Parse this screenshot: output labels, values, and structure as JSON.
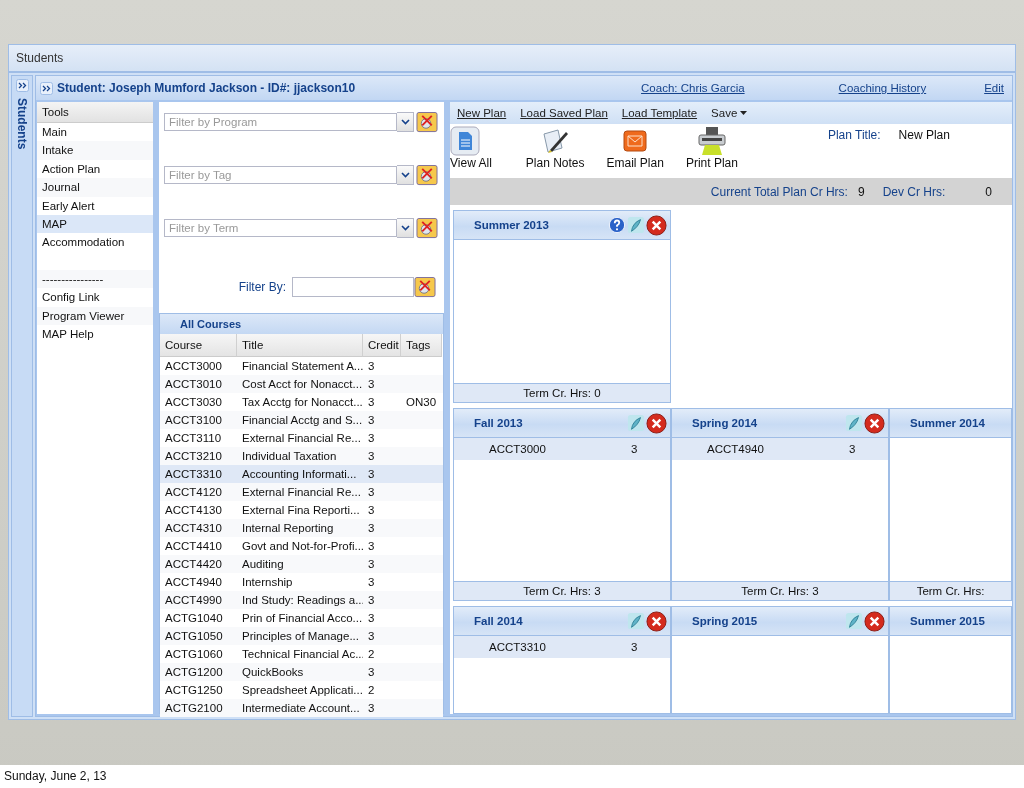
{
  "window": {
    "title": "Students"
  },
  "side_strip": {
    "label": "Students"
  },
  "header": {
    "student": "Student: Joseph Mumford Jackson - ID#: jjackson10",
    "links": [
      "Coach: Chris Garcia",
      "Coaching History",
      "Edit"
    ]
  },
  "tools": {
    "title": "Tools",
    "items": [
      {
        "label": "Main",
        "kind": "item",
        "selected": false
      },
      {
        "label": "Intake",
        "kind": "item",
        "selected": false
      },
      {
        "label": "Action Plan",
        "kind": "item",
        "selected": false
      },
      {
        "label": "Journal",
        "kind": "item",
        "selected": false
      },
      {
        "label": "Early Alert",
        "kind": "item",
        "selected": false
      },
      {
        "label": "MAP",
        "kind": "item",
        "selected": true
      },
      {
        "label": "Accommodation",
        "kind": "item",
        "selected": false
      },
      {
        "label": "----------------",
        "kind": "divider",
        "selected": false
      },
      {
        "label": "Config Link",
        "kind": "item",
        "selected": false
      },
      {
        "label": "Program Viewer",
        "kind": "item",
        "selected": false
      },
      {
        "label": "MAP Help",
        "kind": "item",
        "selected": false
      }
    ]
  },
  "filters": {
    "dropdowns": [
      {
        "placeholder": "Filter by Program"
      },
      {
        "placeholder": "Filter by Tag"
      },
      {
        "placeholder": "Filter by Term"
      }
    ],
    "filter_by": {
      "label": "Filter By:"
    }
  },
  "courses": {
    "title": "All Courses",
    "columns": [
      "Course",
      "Title",
      "Credit",
      "Tags"
    ],
    "rows": [
      {
        "course": "ACCT3000",
        "title": "Financial Statement A...",
        "credit": "3",
        "selected": false
      },
      {
        "course": "ACCT3010",
        "title": "Cost Acct for Nonacct...",
        "credit": "3",
        "selected": false
      },
      {
        "course": "ACCT3030",
        "title": "Tax Acctg for Nonacct...",
        "credit": "3",
        "tags": "ON30",
        "selected": false
      },
      {
        "course": "ACCT3100",
        "title": "Financial Acctg and S...",
        "credit": "3",
        "selected": false
      },
      {
        "course": "ACCT3110",
        "title": "External Financial Re...",
        "credit": "3",
        "selected": false
      },
      {
        "course": "ACCT3210",
        "title": "Individual Taxation",
        "credit": "3",
        "selected": false
      },
      {
        "course": "ACCT3310",
        "title": "Accounting Informati...",
        "credit": "3",
        "selected": true
      },
      {
        "course": "ACCT4120",
        "title": "External Financial Re...",
        "credit": "3",
        "selected": false
      },
      {
        "course": "ACCT4130",
        "title": "External Fina Reporti...",
        "credit": "3",
        "selected": false
      },
      {
        "course": "ACCT4310",
        "title": "Internal Reporting",
        "credit": "3",
        "selected": false
      },
      {
        "course": "ACCT4410",
        "title": "Govt and Not-for-Profi...",
        "credit": "3",
        "selected": false
      },
      {
        "course": "ACCT4420",
        "title": "Auditing",
        "credit": "3",
        "selected": false
      },
      {
        "course": "ACCT4940",
        "title": "Internship",
        "credit": "3",
        "selected": false
      },
      {
        "course": "ACCT4990",
        "title": "Ind Study: Readings a...",
        "credit": "3",
        "selected": false
      },
      {
        "course": "ACTG1040",
        "title": "Prin of Financial Acco...",
        "credit": "3",
        "selected": false
      },
      {
        "course": "ACTG1050",
        "title": "Principles of Manage...",
        "credit": "3",
        "selected": false
      },
      {
        "course": "ACTG1060",
        "title": "Technical Financial Ac...",
        "credit": "2",
        "selected": false
      },
      {
        "course": "ACTG1200",
        "title": "QuickBooks",
        "credit": "3",
        "selected": false
      },
      {
        "course": "ACTG1250",
        "title": "Spreadsheet Applicati...",
        "credit": "2",
        "selected": false
      },
      {
        "course": "ACTG2100",
        "title": "Intermediate Account...",
        "credit": "3",
        "selected": false
      }
    ]
  },
  "plan": {
    "menu": [
      {
        "label": "New Plan",
        "kind": "link"
      },
      {
        "label": "Load Saved Plan",
        "kind": "link"
      },
      {
        "label": "Load Template",
        "kind": "link"
      },
      {
        "label": "Save",
        "kind": "menu"
      }
    ],
    "actions": [
      {
        "label": "View All",
        "kind": "document"
      },
      {
        "label": "Plan Notes",
        "kind": "notes"
      },
      {
        "label": "Email Plan",
        "kind": "email"
      },
      {
        "label": "Print Plan",
        "kind": "print"
      }
    ],
    "plan_title_label": "Plan Title:",
    "plan_title": "New Plan",
    "total_label": "Current Total Plan Cr Hrs:",
    "total": "9",
    "dev_label": "Dev Cr Hrs:",
    "dev": "0",
    "term_rows": [
      [
        {
          "name": "Summer 2013",
          "help_button": true,
          "notes_button": true,
          "remove_button": true,
          "footer": "Term Cr. Hrs: 0"
        }
      ],
      [
        {
          "name": "Fall 2013",
          "help_button": false,
          "notes_button": true,
          "remove_button": true,
          "courses": [
            {
              "code": "ACCT3000",
              "credits": "3"
            }
          ],
          "footer": "Term Cr. Hrs: 3"
        },
        {
          "name": "Spring 2014",
          "help_button": false,
          "notes_button": true,
          "remove_button": true,
          "courses": [
            {
              "code": "ACCT4940",
              "credits": "3"
            }
          ],
          "footer": "Term Cr. Hrs: 3"
        },
        {
          "name": "Summer 2014",
          "help_button": false,
          "notes_button": false,
          "remove_button": false,
          "footer": "Term Cr. Hrs:"
        }
      ],
      [
        {
          "name": "Fall 2014",
          "help_button": false,
          "notes_button": true,
          "remove_button": true,
          "courses": [
            {
              "code": "ACCT3310",
              "credits": "3"
            }
          ]
        },
        {
          "name": "Spring 2015",
          "help_button": false,
          "notes_button": true,
          "remove_button": true
        },
        {
          "name": "Summer 2015",
          "help_button": false,
          "notes_button": false,
          "remove_button": false
        }
      ]
    ]
  },
  "slide_caption": "Sunday, June 2, 13"
}
